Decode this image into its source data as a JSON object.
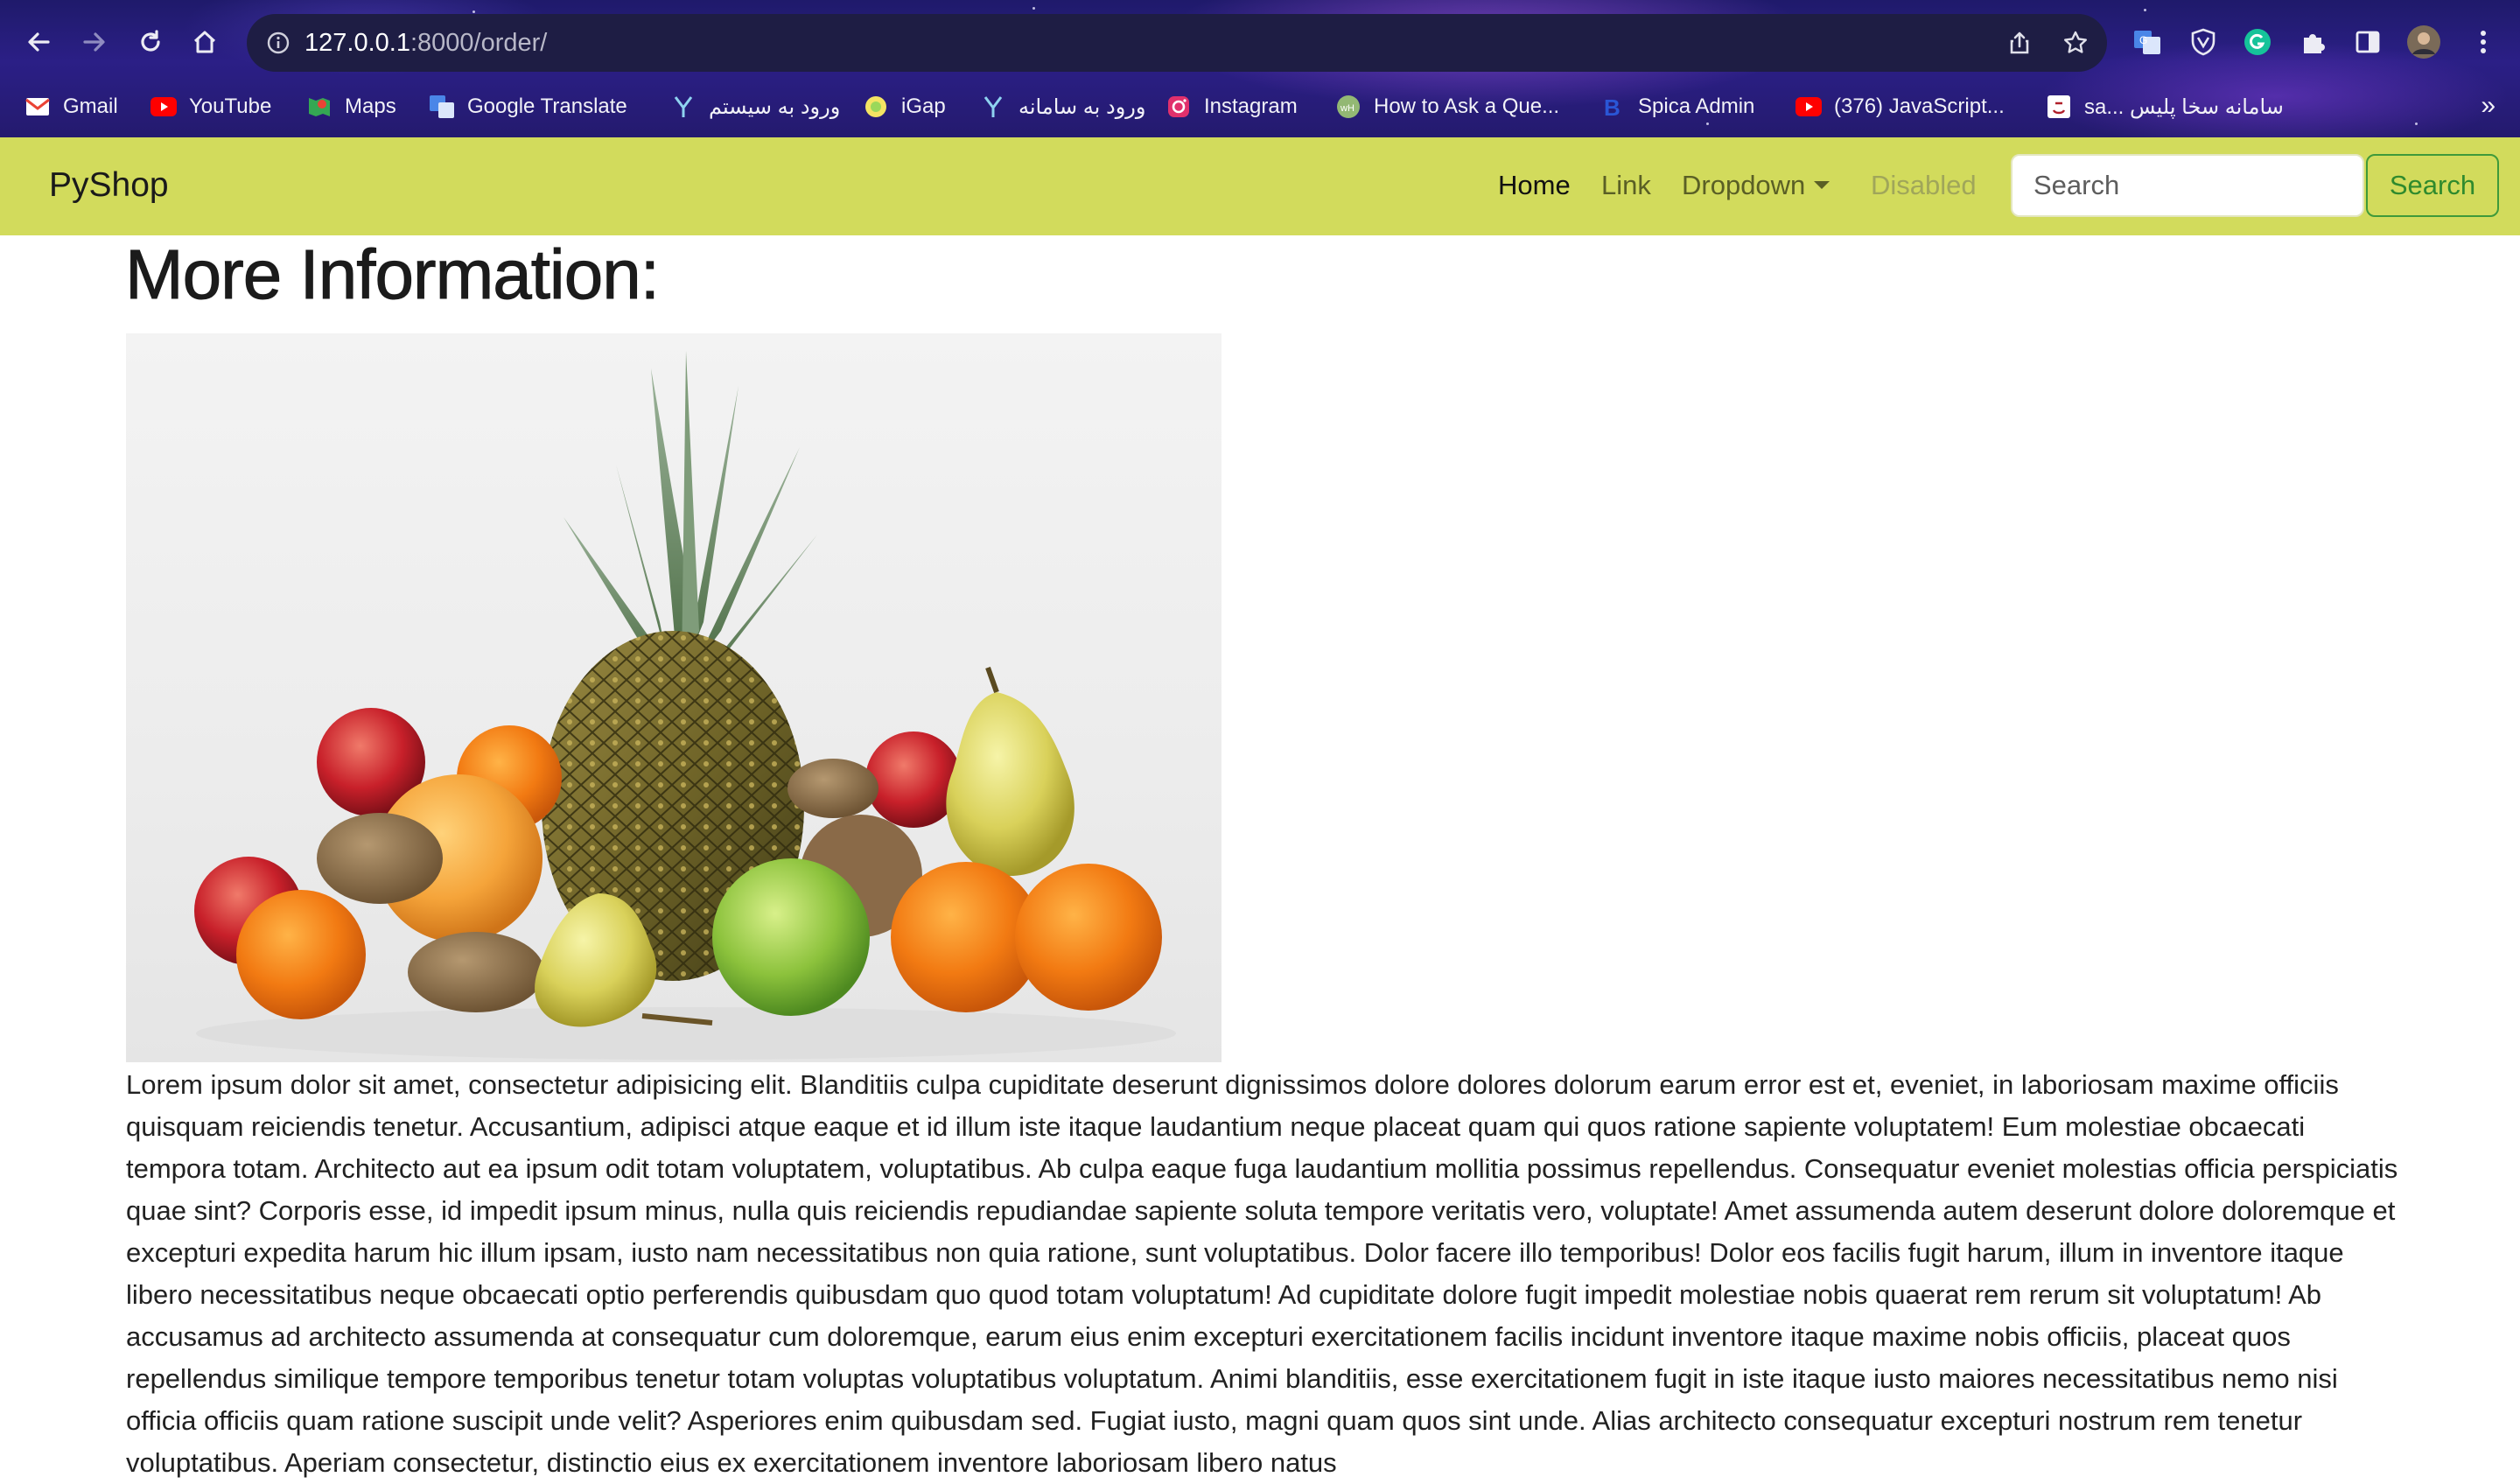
{
  "browser": {
    "url_host": "127.0.0.1",
    "url_path": ":8000/order/",
    "bookmarks": [
      {
        "label": "Gmail",
        "icon": "gmail-icon"
      },
      {
        "label": "YouTube",
        "icon": "youtube-icon"
      },
      {
        "label": "Maps",
        "icon": "maps-icon"
      },
      {
        "label": "Google Translate",
        "icon": "translate-icon"
      },
      {
        "label": "ورود به سیستم",
        "icon": "system-login-icon"
      },
      {
        "label": "iGap",
        "icon": "igap-icon"
      },
      {
        "label": "ورود به سامانه",
        "icon": "portal-login-icon"
      },
      {
        "label": "Instagram",
        "icon": "instagram-icon"
      },
      {
        "label": "How to Ask a Que...",
        "icon": "wikihow-icon"
      },
      {
        "label": "Spica Admin",
        "icon": "spica-icon"
      },
      {
        "label": "(376) JavaScript...",
        "icon": "youtube-icon"
      },
      {
        "label": "sa... سامانه سخا پلیس",
        "icon": "police-icon"
      }
    ],
    "more_label": "»"
  },
  "navbar": {
    "brand": "PyShop",
    "links": {
      "home": "Home",
      "link": "Link",
      "dropdown": "Dropdown",
      "disabled": "Disabled"
    },
    "search_placeholder": "Search",
    "search_button": "Search",
    "colors": {
      "background": "#d2db5c",
      "search_button": "#2f8a2d"
    }
  },
  "main": {
    "title": "More Information:",
    "image_subject": "fruit-still-life",
    "body": "Lorem ipsum dolor sit amet, consectetur adipisicing elit. Blanditiis culpa cupiditate deserunt dignissimos dolore dolores dolorum earum error est et, eveniet, in laboriosam maxime officiis quisquam reiciendis tenetur. Accusantium, adipisci atque eaque et id illum iste itaque laudantium neque placeat quam qui quos ratione sapiente voluptatem! Eum molestiae obcaecati tempora totam. Architecto aut ea ipsum odit totam voluptatem, voluptatibus. Ab culpa eaque fuga laudantium mollitia possimus repellendus. Consequatur eveniet molestias officia perspiciatis quae sint? Corporis esse, id impedit ipsum minus, nulla quis reiciendis repudiandae sapiente soluta tempore veritatis vero, voluptate! Amet assumenda autem deserunt dolore doloremque et excepturi expedita harum hic illum ipsam, iusto nam necessitatibus non quia ratione, sunt voluptatibus. Dolor facere illo temporibus! Dolor eos facilis fugit harum, illum in inventore itaque libero necessitatibus neque obcaecati optio perferendis quibusdam quo quod totam voluptatum! Ad cupiditate dolore fugit impedit molestiae nobis quaerat rem rerum sit voluptatum! Ab accusamus ad architecto assumenda at consequatur cum doloremque, earum eius enim excepturi exercitationem facilis incidunt inventore itaque maxime nobis officiis, placeat quos repellendus similique tempore temporibus tenetur totam voluptas voluptatibus voluptatum. Animi blanditiis, esse exercitationem fugit in iste itaque iusto maiores necessitatibus nemo nisi officia officiis quam ratione suscipit unde velit? Asperiores enim quibusdam sed. Fugiat iusto, magni quam quos sint unde. Alias architecto consequatur excepturi nostrum rem tenetur voluptatibus. Aperiam consectetur, distinctio eius ex exercitationem inventore laboriosam libero natus"
  }
}
